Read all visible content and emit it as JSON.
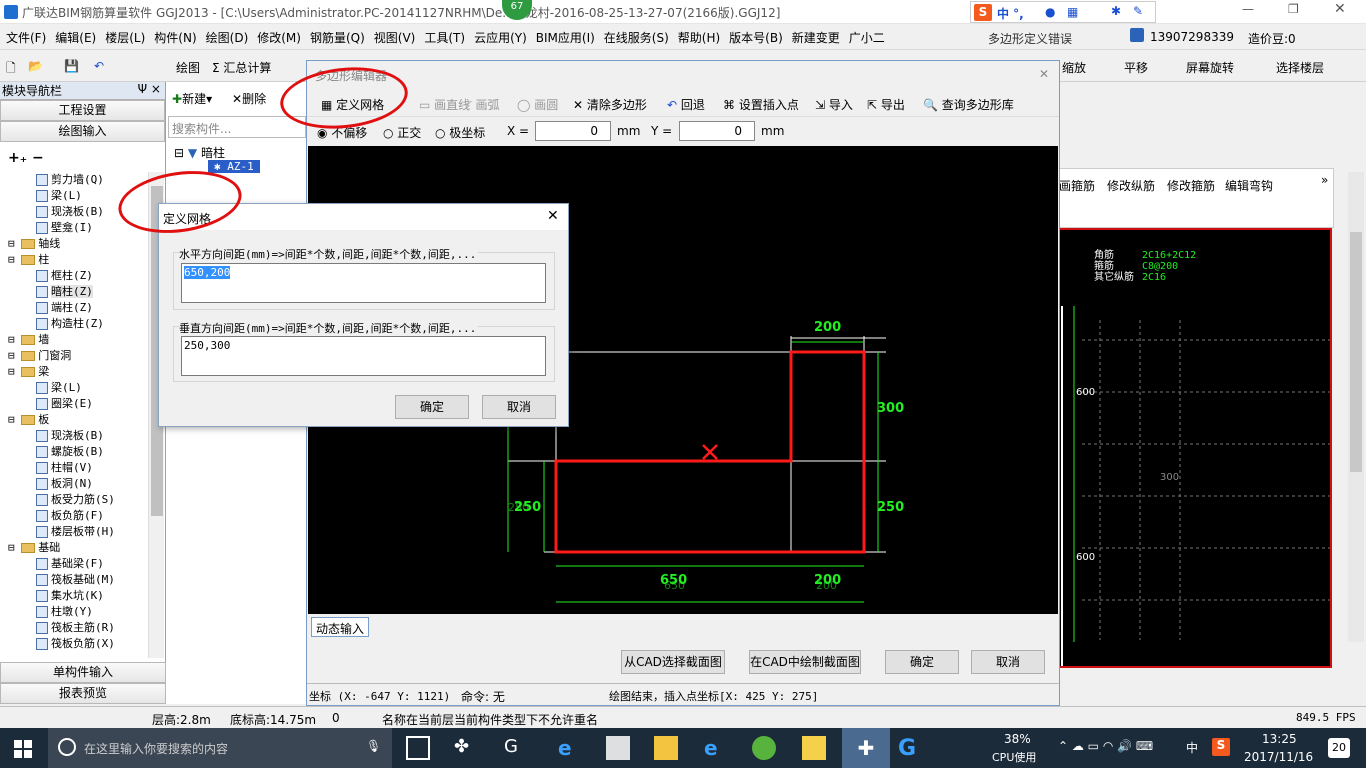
{
  "title": {
    "text": "广联达BIM钢筋算量软件 GGJ2013 - [C:\\Users\\Administrator.PC-20141127NRHM\\De...白龙村-2016-08-25-13-27-07(2166版).GGJ12]",
    "badge": "67",
    "phone": "13907298339",
    "bean": "造价豆:0",
    "ime": "中 °,"
  },
  "menubar": {
    "items": [
      "文件(F)",
      "编辑(E)",
      "楼层(L)",
      "构件(N)",
      "绘图(D)",
      "修改(M)",
      "钢筋量(Q)",
      "视图(V)",
      "工具(T)",
      "云应用(Y)",
      "BIM应用(I)",
      "在线服务(S)",
      "帮助(H)",
      "版本号(B)",
      "新建变更",
      "广小二"
    ],
    "alert": "多边形定义错误"
  },
  "toolbar": {
    "draw": "绘图",
    "sum": "Σ 汇总计算",
    "zoom": "缩放",
    "pan": "平移",
    "rotate": "屏幕旋转",
    "floor": "选择楼层"
  },
  "leftpane": {
    "title": "模块导航栏",
    "pin": "Ψ ×",
    "tabs": [
      "工程设置",
      "绘图输入"
    ],
    "bottom": [
      "单构件输入",
      "报表预览"
    ],
    "tree": [
      {
        "t": "剪力墙(Q)",
        "l": 2,
        "k": "i"
      },
      {
        "t": "梁(L)",
        "l": 2,
        "k": "i"
      },
      {
        "t": "现浇板(B)",
        "l": 2,
        "k": "i"
      },
      {
        "t": "壁龛(I)",
        "l": 2,
        "k": "i"
      },
      {
        "t": "轴线",
        "l": 1,
        "k": "f"
      },
      {
        "t": "柱",
        "l": 1,
        "k": "f"
      },
      {
        "t": "框柱(Z)",
        "l": 2,
        "k": "i"
      },
      {
        "t": "暗柱(Z)",
        "l": 2,
        "k": "i"
      },
      {
        "t": "端柱(Z)",
        "l": 2,
        "k": "i"
      },
      {
        "t": "构造柱(Z)",
        "l": 2,
        "k": "i"
      },
      {
        "t": "墙",
        "l": 1,
        "k": "f"
      },
      {
        "t": "门窗洞",
        "l": 1,
        "k": "f"
      },
      {
        "t": "梁",
        "l": 1,
        "k": "f"
      },
      {
        "t": "梁(L)",
        "l": 2,
        "k": "i"
      },
      {
        "t": "圈梁(E)",
        "l": 2,
        "k": "i"
      },
      {
        "t": "板",
        "l": 1,
        "k": "f"
      },
      {
        "t": "现浇板(B)",
        "l": 2,
        "k": "i"
      },
      {
        "t": "螺旋板(B)",
        "l": 2,
        "k": "i"
      },
      {
        "t": "柱帽(V)",
        "l": 2,
        "k": "i"
      },
      {
        "t": "板洞(N)",
        "l": 2,
        "k": "i"
      },
      {
        "t": "板受力筋(S)",
        "l": 2,
        "k": "i"
      },
      {
        "t": "板负筋(F)",
        "l": 2,
        "k": "i"
      },
      {
        "t": "楼层板带(H)",
        "l": 2,
        "k": "i"
      },
      {
        "t": "基础",
        "l": 1,
        "k": "f"
      },
      {
        "t": "基础梁(F)",
        "l": 2,
        "k": "i"
      },
      {
        "t": "筏板基础(M)",
        "l": 2,
        "k": "i"
      },
      {
        "t": "集水坑(K)",
        "l": 2,
        "k": "i"
      },
      {
        "t": "柱墩(Y)",
        "l": 2,
        "k": "i"
      },
      {
        "t": "筏板主筋(R)",
        "l": 2,
        "k": "i"
      },
      {
        "t": "筏板负筋(X)",
        "l": 2,
        "k": "i"
      }
    ]
  },
  "midpane": {
    "new": "新建",
    "delete": "删除",
    "search": "搜索构件...",
    "node": "暗柱",
    "child": "AZ-1"
  },
  "polywin": {
    "title": "多边形编辑器",
    "tools": [
      "定义网格",
      "画直线",
      "画弧",
      "画圆",
      "清除多边形",
      "回退",
      "设置插入点",
      "导入",
      "导出",
      "查询多边形库"
    ],
    "mode": [
      "不偏移",
      "正交",
      "极坐标"
    ],
    "xlabel": "X =",
    "xval": "0",
    "ylabel": "Y =",
    "yval": "0",
    "unit": "mm",
    "dyn": "动态输入",
    "btns": [
      "从CAD选择截面图",
      "在CAD中绘制截面图",
      "确定",
      "取消"
    ],
    "coord": "坐标 (X: -647 Y: 1121)",
    "cmd": "命令: 无",
    "status": "绘图结束，插入点坐标[X: 425 Y: 275]"
  },
  "drawing": {
    "dims": [
      "200",
      "300",
      "250",
      "650",
      "200"
    ],
    "left": "250",
    "ghost": [
      "250",
      "650",
      "200"
    ],
    "colors": {
      "shape": "#ff1a1a",
      "dim": "#22ee22",
      "grid": "#ffffff"
    }
  },
  "rightpanel": {
    "tabs": [
      "画箍筋",
      "修改纵筋",
      "修改箍筋",
      "编辑弯钩"
    ],
    "legend": [
      [
        "角筋",
        "2C16+2C12"
      ],
      [
        "箍筋",
        "C8@200"
      ],
      [
        "其它纵筋",
        "2C16"
      ]
    ],
    "dims": [
      "600",
      "300",
      "600"
    ]
  },
  "gridDlg": {
    "title": "定义网格",
    "hlabel": "水平方向间距(mm)=>间距*个数,间距,间距*个数,间距,...",
    "hval": "650,200",
    "vlabel": "垂直方向间距(mm)=>间距*个数,间距,间距*个数,间距,...",
    "vval": "250,300",
    "ok": "确定",
    "cancel": "取消"
  },
  "statusbar": {
    "floor": "层高:2.8m",
    "base": "底标高:14.75m",
    "zero": "0",
    "msg": "名称在当前层当前构件类型下不允许重名",
    "fps": "849.5 FPS"
  },
  "taskbar": {
    "search": "在这里输入你要搜索的内容",
    "cpu": "38%",
    "cpu_label": "CPU使用",
    "lang": "中",
    "time": "13:25",
    "date": "2017/11/16",
    "notif": "20"
  }
}
